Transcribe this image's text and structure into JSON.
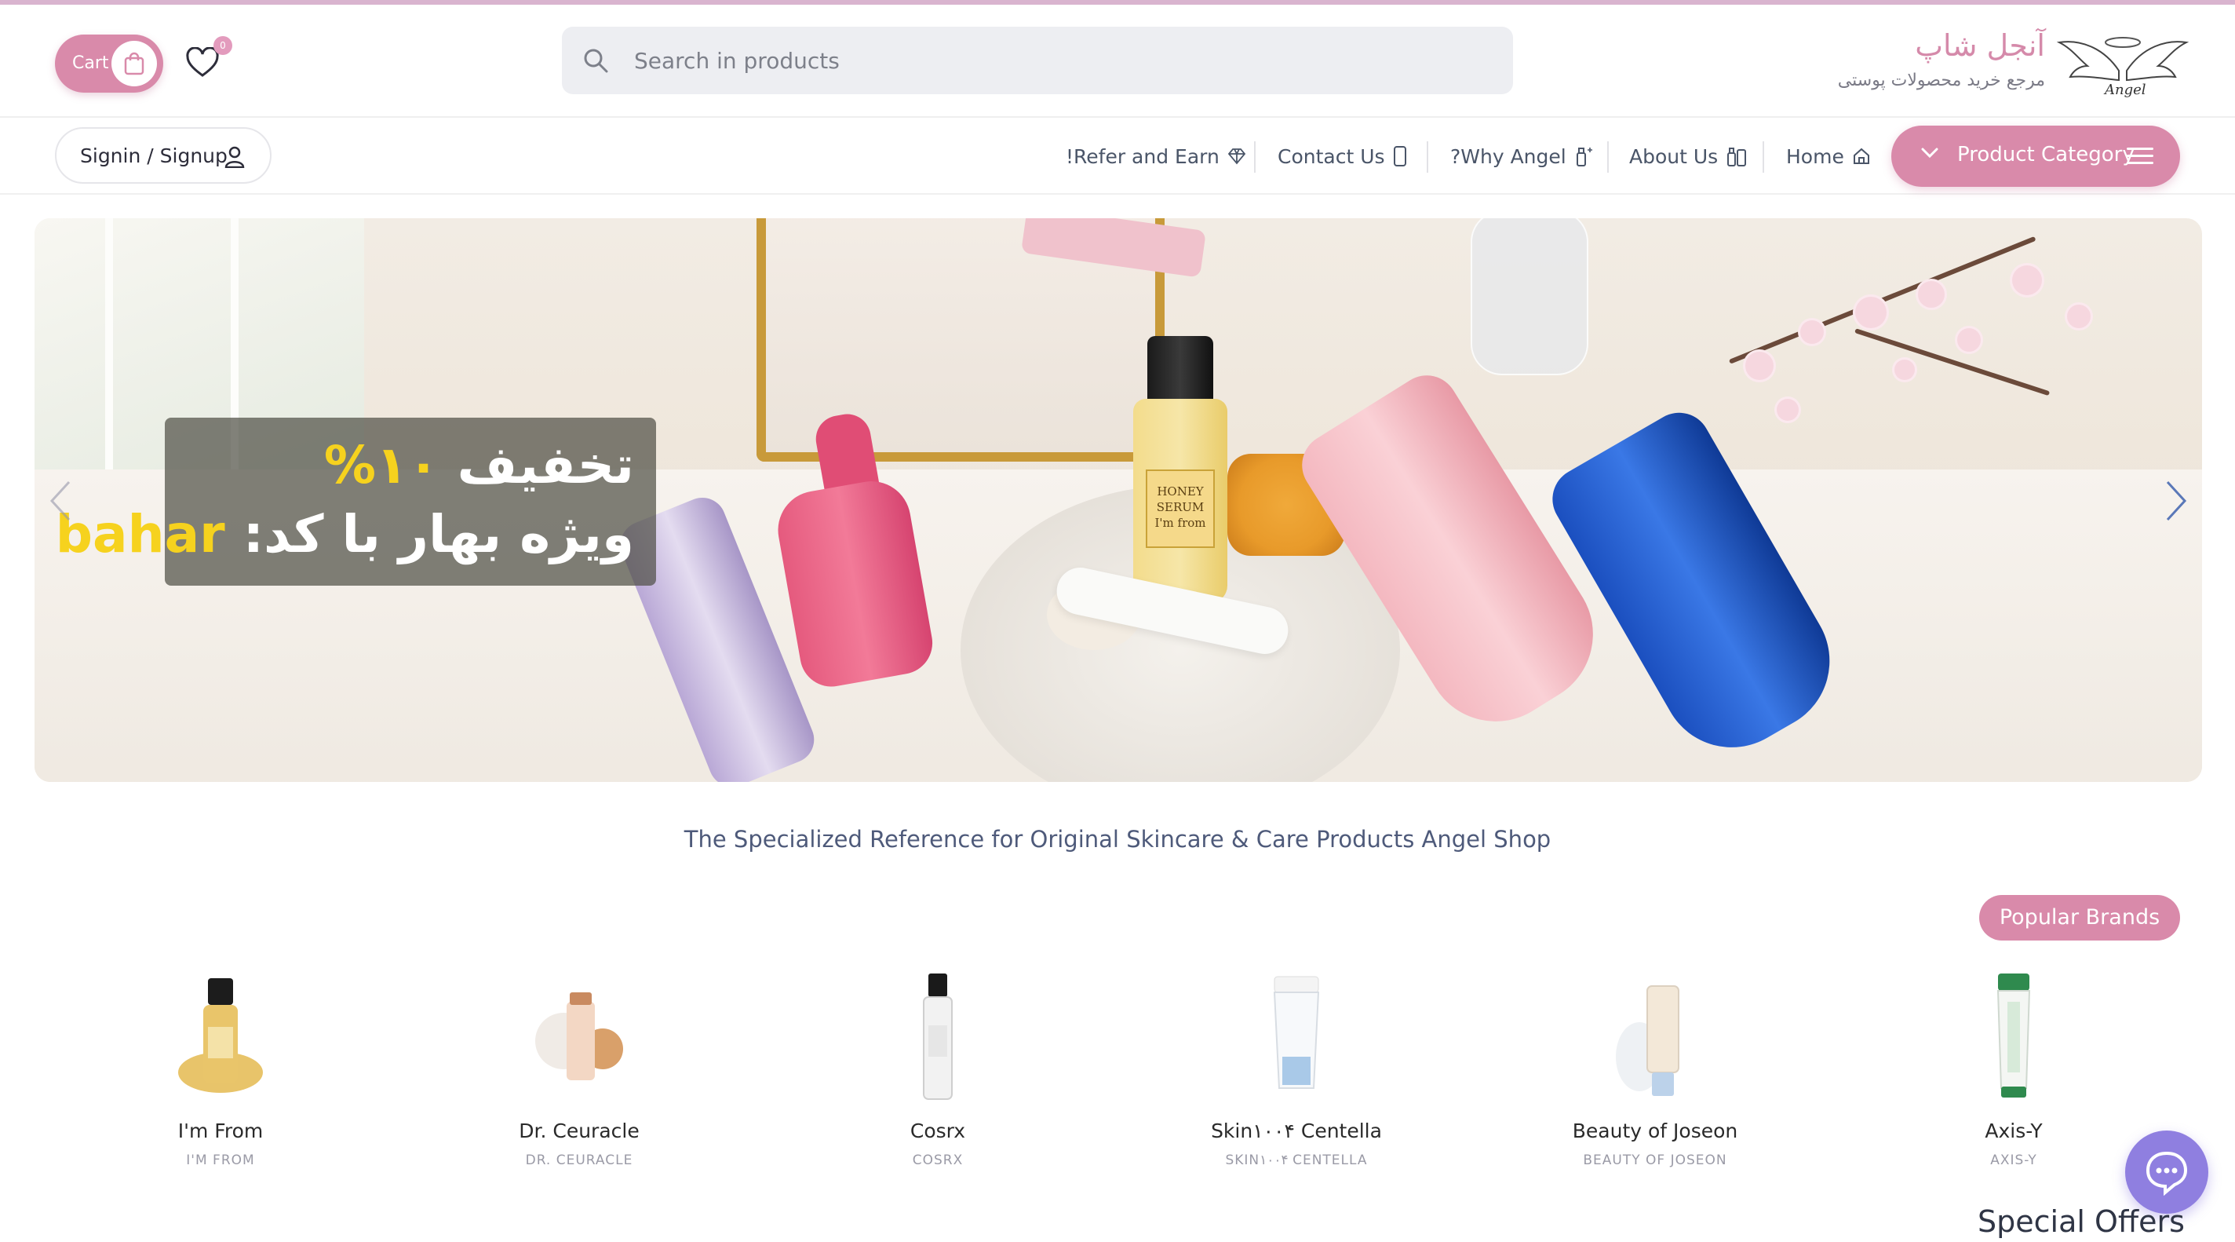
{
  "header": {
    "cart_label": "Cart",
    "wishlist_count": "0",
    "search_placeholder": "Search in products",
    "logo_title": "آنجل شاپ",
    "logo_subtitle": "مرجع خرید محصولات پوستی",
    "logo_mark_text": "Angel"
  },
  "nav": {
    "signin_label": "Signin / Signup",
    "items": [
      {
        "label": "!Refer and Earn",
        "icon": "diamond-icon"
      },
      {
        "label": "Contact Us",
        "icon": "phone-icon"
      },
      {
        "label": "?Why Angel",
        "icon": "bottle-sparkle-icon"
      },
      {
        "label": "About Us",
        "icon": "cosmetics-icon"
      },
      {
        "label": "Home",
        "icon": "home-icon"
      }
    ],
    "category_label": "Product Category"
  },
  "banner": {
    "promo_line1_prefix": "تخفیف",
    "promo_line1_highlight": "۱۰%",
    "promo_line2_prefix": "ویژه بهار با کد:",
    "promo_line2_highlight": "bahar",
    "honey_label": "HONEY SERUM I'm from"
  },
  "tagline": "The Specialized Reference for Original Skincare & Care Products  Angel Shop",
  "popular_brands": {
    "label": "Popular Brands",
    "brands": [
      {
        "name": "I'm From",
        "sub": "I'M FROM"
      },
      {
        "name": "Dr. Ceuracle",
        "sub": "DR. CEURACLE"
      },
      {
        "name": "Cosrx",
        "sub": "COSRX"
      },
      {
        "name": "Skin۱۰۰۴ Centella",
        "sub": "SKIN۱۰۰۴ CENTELLA"
      },
      {
        "name": "Beauty of Joseon",
        "sub": "BEAUTY OF JOSEON"
      },
      {
        "name": "Axis-Y",
        "sub": "AXIS-Y"
      }
    ]
  },
  "special_offers_title": "Special Offers",
  "colors": {
    "accent_pink": "#d98aaa",
    "chat_purple": "#8f7fe0",
    "promo_yellow": "#f6d21e",
    "text_slate": "#4e5a7a"
  }
}
